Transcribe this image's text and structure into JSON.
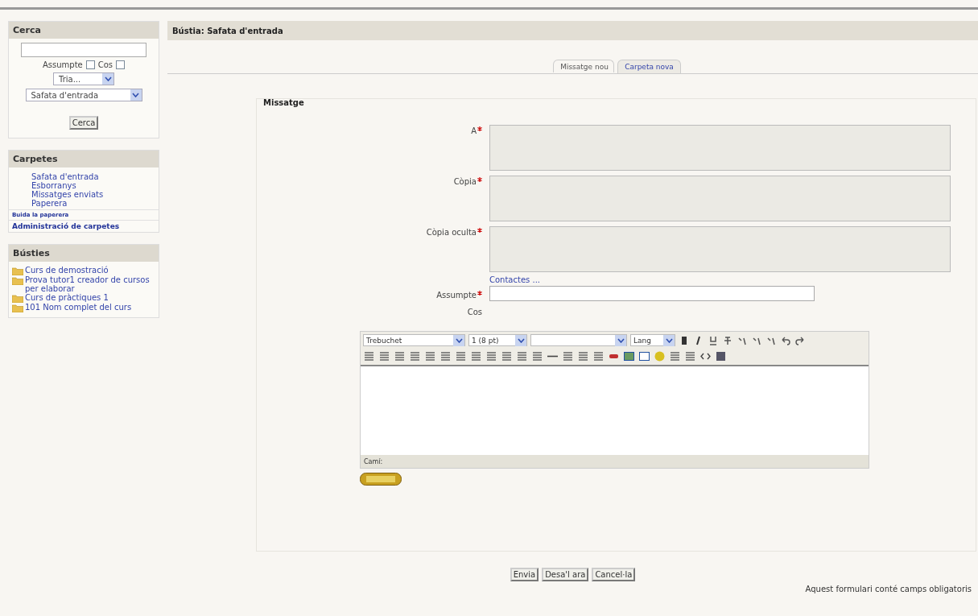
{
  "search_block": {
    "title": "Cerca",
    "checkboxes": [
      {
        "label": "Assumpte",
        "checked": false
      },
      {
        "label": "Cos",
        "checked": false
      }
    ],
    "selects": [
      "Tria...",
      "Safata d'entrada"
    ],
    "button": "Cerca"
  },
  "folders_block": {
    "title": "Carpetes",
    "folders": [
      "Safata d'entrada",
      "Esborranys",
      "Missatges enviats",
      "Paperera"
    ],
    "actions": [
      "Buida la paperera",
      "Administració de carpetes"
    ]
  },
  "mailboxes_block": {
    "title": "Bústies",
    "items": [
      "Curs de demostració",
      "Prova tutor1 creador de cursos per elaborar",
      "Curs de pràctiques 1",
      "101 Nom complet del curs"
    ]
  },
  "header": {
    "title": "Bústia: Safata d'entrada"
  },
  "tabs": [
    {
      "label": "Missatge nou",
      "selected": true
    },
    {
      "label": "Carpeta nova",
      "selected": false
    }
  ],
  "form": {
    "legend": "Missatge",
    "recipients": [
      {
        "label": "A",
        "required": true
      },
      {
        "label": "Còpia",
        "required": true
      },
      {
        "label": "Còpia oculta",
        "required": true
      }
    ],
    "contacts_link": "Contactes ...",
    "subject": {
      "label": "Assumpte",
      "required": true
    },
    "body_label": "Cos",
    "editor": {
      "font": "Trebuchet",
      "size": "1 (8 pt)",
      "lang": "Lang",
      "path_label": "Camí:"
    }
  },
  "buttons": [
    "Envia",
    "Desa'l ara",
    "Cancel·la"
  ],
  "footer_note": "Aquest formulari conté camps obligatoris"
}
